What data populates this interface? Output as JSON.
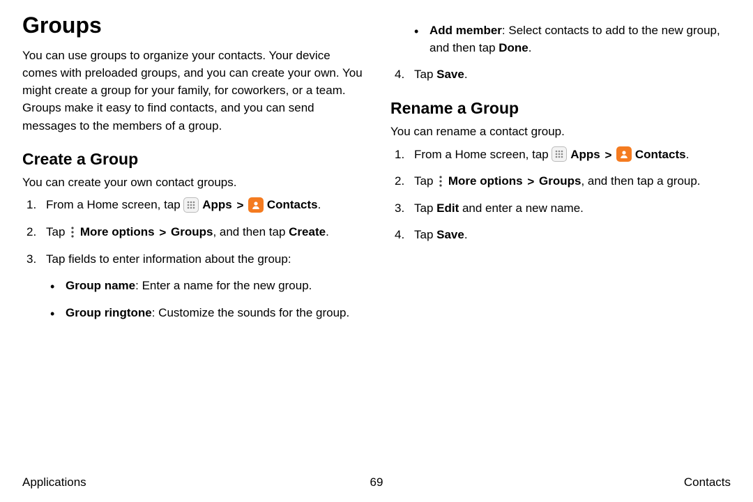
{
  "title": "Groups",
  "intro": "You can use groups to organize your contacts. Your device comes with preloaded groups, and you can create your own. You might create a group for your family, for coworkers, or a team. Groups make it easy to find contacts, and you can send messages to the members of a group.",
  "create": {
    "heading": "Create a Group",
    "sub": "You can create your own contact groups.",
    "step1_pre": "From a Home screen, tap ",
    "step1_apps": "Apps",
    "step1_contacts": "Contacts",
    "step2_pre": "Tap ",
    "step2_more": "More options",
    "step2_groups": "Groups",
    "step2_tail": ", and then tap ",
    "step2_create": "Create",
    "step3": "Tap fields to enter information about the group:",
    "bullet1_label": "Group name",
    "bullet1_text": ": Enter a name for the new group.",
    "bullet2_label": "Group ringtone",
    "bullet2_text": ": Customize the sounds for the group.",
    "bullet3_label": "Add member",
    "bullet3_text": ": Select contacts to add to the new group, and then tap ",
    "bullet3_done": "Done",
    "step4_pre": "Tap ",
    "step4_save": "Save"
  },
  "rename": {
    "heading": "Rename a Group",
    "sub": "You can rename a contact group.",
    "step1_pre": "From a Home screen, tap ",
    "step1_apps": "Apps",
    "step1_contacts": "Contacts",
    "step2_pre": "Tap ",
    "step2_more": "More options",
    "step2_groups": "Groups",
    "step2_tail": ", and then tap a group.",
    "step3_pre": "Tap ",
    "step3_edit": "Edit",
    "step3_tail": " and enter a new name.",
    "step4_pre": "Tap ",
    "step4_save": "Save"
  },
  "footer": {
    "left": "Applications",
    "page": "69",
    "right": "Contacts"
  },
  "chevron": ">"
}
